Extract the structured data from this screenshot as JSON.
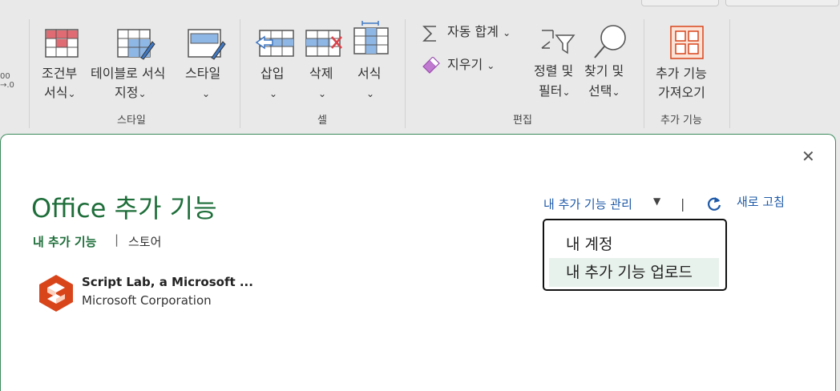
{
  "ribbon": {
    "partial_num": {
      "line1": "00",
      "line2": "→.0"
    },
    "styles_group": {
      "label": "스타일",
      "conditional_format": {
        "line1": "조건부",
        "line2": "서식"
      },
      "format_as_table": {
        "line1": "테이블로 서식",
        "line2": "지정"
      },
      "cell_styles": {
        "line1": "스타일"
      }
    },
    "cells_group": {
      "label": "셀",
      "insert": "삽입",
      "delete": "삭제",
      "format": "서식"
    },
    "editing_group": {
      "label": "편집",
      "autosum": "자동 합계",
      "clear": "지우기",
      "sort_filter": {
        "line1": "정렬 및",
        "line2": "필터"
      },
      "find_select": {
        "line1": "찾기 및",
        "line2": "선택"
      }
    },
    "addins_group": {
      "label": "추가 기능",
      "get_addins": {
        "line1": "추가 기능",
        "line2": "가져오기"
      }
    },
    "chevron": "⌄"
  },
  "dialog": {
    "close_glyph": "✕",
    "title": "Office 추가 기능",
    "tabs": {
      "my_addins": "내 추가 기능",
      "separator": "|",
      "store": "스토어"
    },
    "addin": {
      "name": "Script Lab, a Microsoft ...",
      "publisher": "Microsoft Corporation"
    },
    "manage_link": "내 추가 기능 관리",
    "manage_caret": "▼",
    "bar_separator": "|",
    "refresh_label": "새로 고침",
    "menu": {
      "items": [
        {
          "label": "내 계정"
        },
        {
          "label": "내 추가 기능 업로드"
        }
      ]
    }
  },
  "colors": {
    "accent_green": "#1e6e3a",
    "link_blue": "#1e5aa8",
    "ribbon_bg": "#e9e9e9",
    "menu_hover": "#e8f2ec",
    "brand_orange": "#d9451b"
  },
  "icons": {
    "conditional_format": "conditional-format-icon",
    "format_as_table": "format-as-table-icon",
    "cell_styles": "cell-styles-icon",
    "insert": "insert-cells-icon",
    "delete": "delete-cells-icon",
    "format": "format-cells-icon",
    "autosum": "sigma-icon",
    "clear": "eraser-icon",
    "sort_filter": "sort-filter-icon",
    "find_select": "magnifier-icon",
    "get_addins": "addins-grid-icon",
    "close": "close-icon",
    "refresh": "refresh-icon",
    "addin": "script-lab-icon"
  }
}
